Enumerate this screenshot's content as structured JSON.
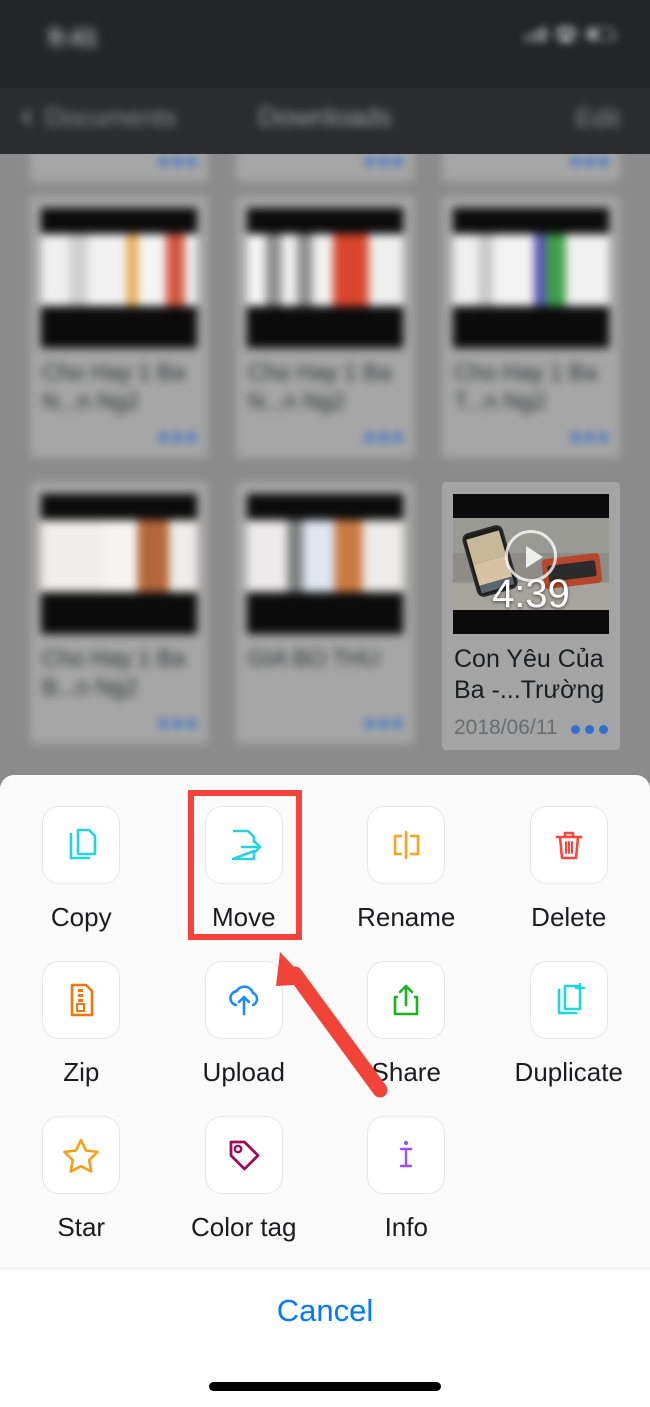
{
  "status_bar": {
    "time": "9:41",
    "icons": [
      "signal-icon",
      "wifi-icon",
      "battery-icon"
    ]
  },
  "nav_bar": {
    "back_label": "Documents",
    "title": "Downloads",
    "edit_label": "Edit",
    "back_icon": "chevron-left-icon"
  },
  "file_grid": {
    "rows": [
      [
        {
          "name": "",
          "date": "",
          "selected": false
        },
        {
          "name": "",
          "date": "",
          "selected": false
        },
        {
          "name": "",
          "date": "",
          "selected": false
        }
      ],
      [
        {
          "name": "Cho Hay 1 Ba N...n Ng2",
          "date": "",
          "selected": false
        },
        {
          "name": "Cho Hay 1 Ba N...n Ng2",
          "date": "",
          "selected": false
        },
        {
          "name": "Cho Hay 1 Ba T...n Ng2",
          "date": "",
          "selected": false
        }
      ],
      [
        {
          "name": "Cho Hay 1 Ba B...n Ng2",
          "date": "",
          "selected": false
        },
        {
          "name": "GIA BO THU",
          "date": "",
          "selected": false
        },
        {
          "name": "Con Yêu Của Ba -...Trường",
          "date": "2018/06/11",
          "duration": "4:39",
          "selected": true,
          "menu_icon": "more-dots-icon",
          "play_icon": "play-circle-icon"
        }
      ]
    ]
  },
  "action_sheet": {
    "actions": [
      {
        "label": "Copy",
        "icon": "copy-icon",
        "color": "#22d3e0",
        "highlighted": false
      },
      {
        "label": "Move",
        "icon": "move-icon",
        "color": "#22d3e0",
        "highlighted": true
      },
      {
        "label": "Rename",
        "icon": "rename-icon",
        "color": "#f5a623",
        "highlighted": false
      },
      {
        "label": "Delete",
        "icon": "trash-icon",
        "color": "#ff453a",
        "highlighted": false
      },
      {
        "label": "Zip",
        "icon": "zip-icon",
        "color": "#f2760c",
        "highlighted": false
      },
      {
        "label": "Upload",
        "icon": "cloud-upload-icon",
        "color": "#1a8cff",
        "highlighted": false
      },
      {
        "label": "Share",
        "icon": "share-icon",
        "color": "#17b51a",
        "highlighted": false
      },
      {
        "label": "Duplicate",
        "icon": "duplicate-icon",
        "color": "#22d3e0",
        "highlighted": false
      },
      {
        "label": "Star",
        "icon": "star-icon",
        "color": "#f79e15",
        "highlighted": false
      },
      {
        "label": "Color tag",
        "icon": "tag-icon",
        "color": "#9b0f5a",
        "highlighted": false
      },
      {
        "label": "Info",
        "icon": "info-icon",
        "color": "#9b4dff",
        "highlighted": false
      }
    ],
    "cancel_label": "Cancel"
  },
  "annotations": {
    "highlight_color": "#f9423a",
    "arrow_color": "#f04438",
    "highlight_target": "Move",
    "arrow_target": "Move"
  },
  "colors": {
    "accent_blue": "#007aff",
    "sheet_bg": "#fafafa",
    "dim_overlay": "#8b8b8b"
  }
}
